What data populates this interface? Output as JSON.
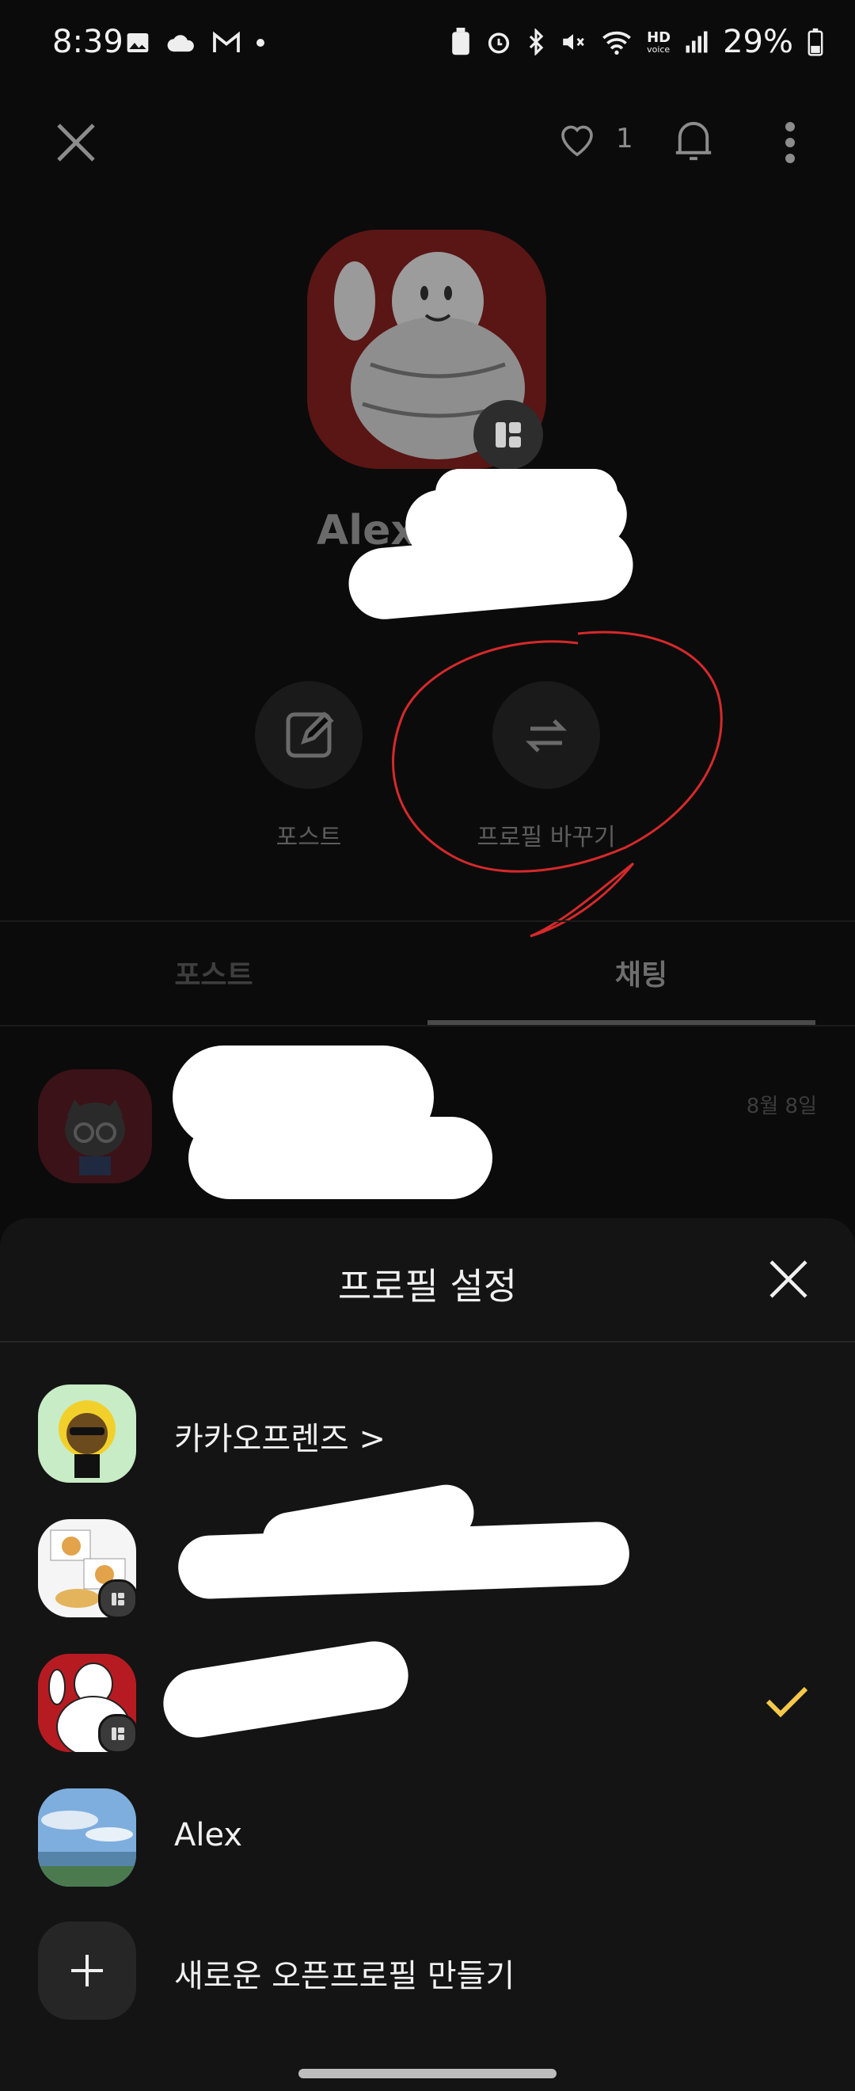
{
  "status_bar": {
    "time": "8:39",
    "network": "HD",
    "network_sub": "voice",
    "battery": "29%"
  },
  "header": {
    "like_count": "1"
  },
  "profile": {
    "name": "Alex"
  },
  "actions": {
    "post_label": "포스트",
    "switch_profile_label": "프로필 바꾸기"
  },
  "tabs": [
    {
      "label": "포스트"
    },
    {
      "label": "채팅"
    }
  ],
  "chat": {
    "date": "8월 8일"
  },
  "sheet": {
    "title": "프로필 설정",
    "items": [
      {
        "label": "카카오프렌즈 >"
      },
      {
        "label": ""
      },
      {
        "label": ""
      },
      {
        "label": "Alex"
      },
      {
        "label": "새로운 오픈프로필 만들기"
      }
    ]
  },
  "colors": {
    "accent_check": "#f5c84b",
    "annotation_red": "#d6292b"
  }
}
